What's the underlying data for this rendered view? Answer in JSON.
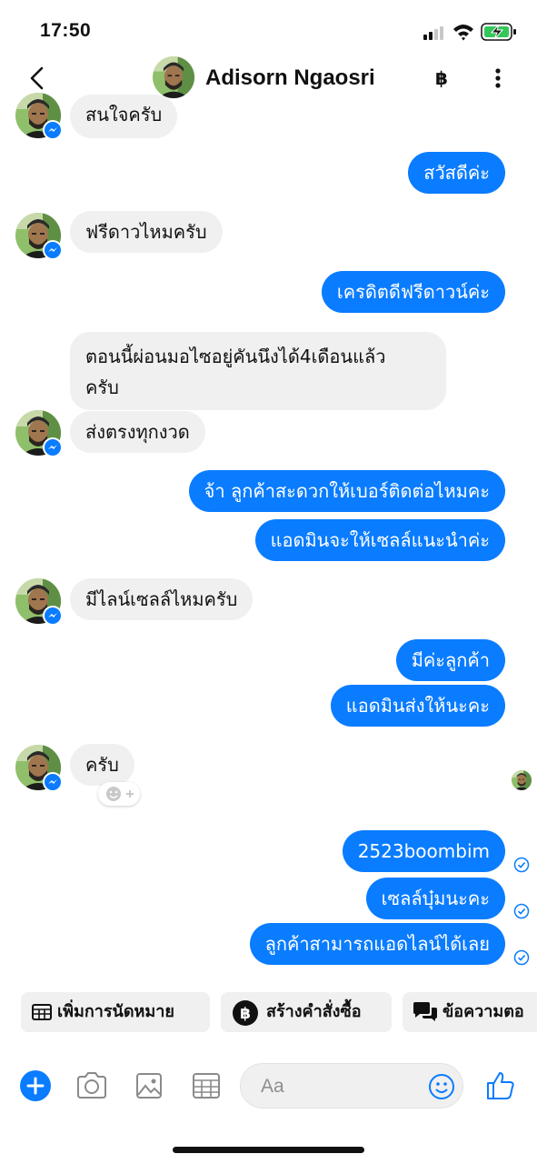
{
  "status_bar": {
    "time": "17:50"
  },
  "header": {
    "contact_name": "Adisorn Ngaosri",
    "currency_button": "฿"
  },
  "messages": [
    {
      "text": "สนใจครับ"
    },
    {
      "text": "สวัสดีค่ะ"
    },
    {
      "text": "ฟรีดาวไหมครับ"
    },
    {
      "text": "เครดิตดีฟรีดาวน์ค่ะ"
    },
    {
      "text": "ตอนนี้ผ่อนมอไซอยู่คันนึงได้4เดือนแล้ว"
    },
    {
      "text": "ครับ"
    },
    {
      "text": "ส่งตรงทุกงวด"
    },
    {
      "text": "จ้า ลูกค้าสะดวกให้เบอร์ติดต่อไหมคะ"
    },
    {
      "text": "แอดมินจะให้เซลล์แนะนำค่ะ"
    },
    {
      "text": "มีไลน์เซลล์ไหมครับ"
    },
    {
      "text": "มีค่ะลูกค้า"
    },
    {
      "text": "แอดมินส่งให้นะคะ"
    },
    {
      "text": "ครับ"
    },
    {
      "text": "2523boombim"
    },
    {
      "text": "เซลล์บุ๋มนะคะ"
    },
    {
      "text": "ลูกค้าสามารถแอดไลน์ได้เลย"
    }
  ],
  "quick_replies": [
    {
      "label": "เพิ่มการนัดหมาย",
      "icon": "calendar-icon"
    },
    {
      "label": "สร้างคำสั่งซื้อ",
      "icon": "baht-icon"
    },
    {
      "label": "ข้อความตอ",
      "icon": "chat-bubbles-icon"
    }
  ],
  "composer": {
    "placeholder": "Aa"
  },
  "colors": {
    "accent": "#0a7cff",
    "incoming_bubble": "#f0f0f0",
    "outgoing_text": "#ffffff",
    "battery_fill": "#34c759"
  }
}
